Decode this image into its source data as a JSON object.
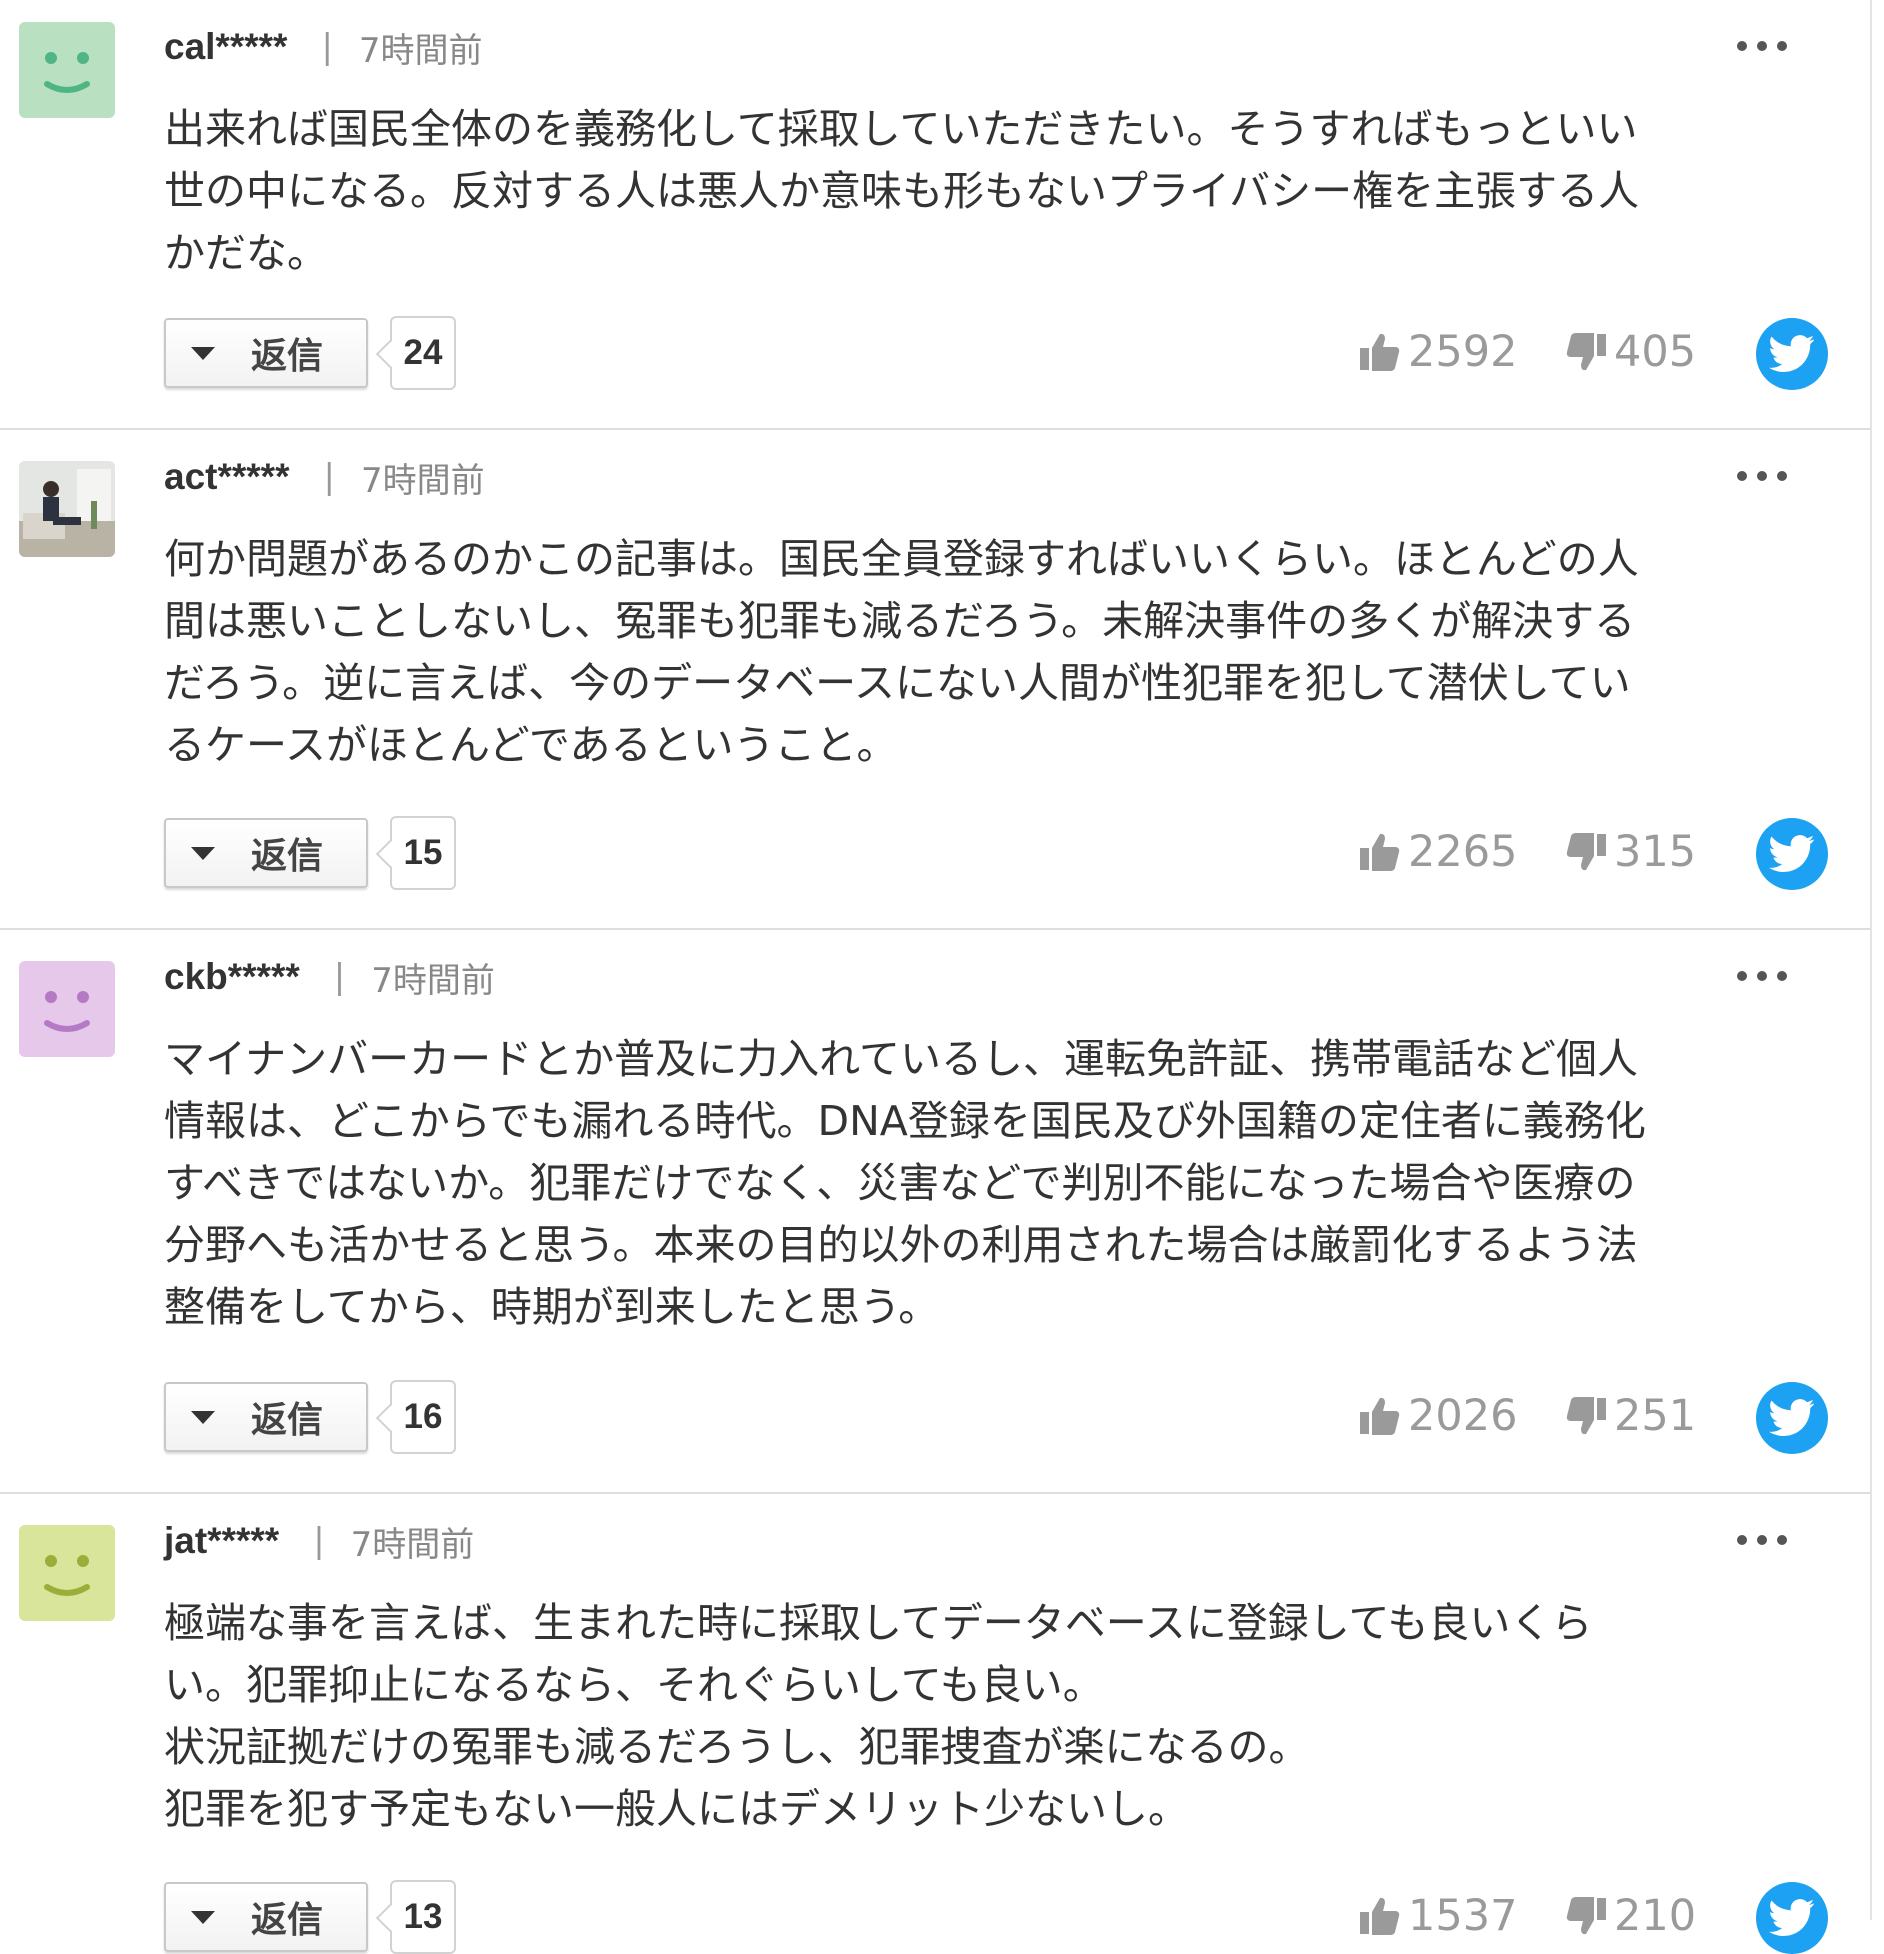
{
  "comments": [
    {
      "user": "cal*****",
      "separator": "|",
      "time": "7時間前",
      "avatar_color": "#b9e0c0",
      "avatar_face": "#4fb584",
      "text": "出来れば国民全体のを義務化して採取していただきたい。そうすればもっといい\n世の中になる。反対する人は悪人か意味も形もないプライバシー権を主張する人\nかだな。",
      "reply_label": "返信",
      "reply_count": "24",
      "likes": "2592",
      "dislikes": "405"
    },
    {
      "user": "act*****",
      "separator": "|",
      "time": "7時間前",
      "avatar_color": "photo",
      "text": "何か問題があるのかこの記事は。国民全員登録すればいいくらい。ほとんどの人\n間は悪いことしないし、冤罪も犯罪も減るだろう。未解決事件の多くが解決する\nだろう。逆に言えば、今のデータベースにない人間が性犯罪を犯して潜伏してい\nるケースがほとんどであるということ。",
      "reply_label": "返信",
      "reply_count": "15",
      "likes": "2265",
      "dislikes": "315"
    },
    {
      "user": "ckb*****",
      "separator": "|",
      "time": "7時間前",
      "avatar_color": "#e6c8ea",
      "avatar_face": "#b57ac6",
      "text": "マイナンバーカードとか普及に力入れているし、運転免許証、携帯電話など個人\n情報は、どこからでも漏れる時代。DNA登録を国民及び外国籍の定住者に義務化\nすべきではないか。犯罪だけでなく、災害などで判別不能になった場合や医療の\n分野へも活かせると思う。本来の目的以外の利用された場合は厳罰化するよう法\n整備をしてから、時期が到来したと思う。",
      "reply_label": "返信",
      "reply_count": "16",
      "likes": "2026",
      "dislikes": "251"
    },
    {
      "user": "jat*****",
      "separator": "|",
      "time": "7時間前",
      "avatar_color": "#d9e59a",
      "avatar_face": "#9aae3a",
      "text": "極端な事を言えば、生まれた時に採取してデータベースに登録しても良いくら\nい。犯罪抑止になるなら、それぐらいしても良い。\n状況証拠だけの冤罪も減るだろうし、犯罪捜査が楽になるの。\n犯罪を犯す予定もない一般人にはデメリット少ないし。",
      "reply_label": "返信",
      "reply_count": "13",
      "likes": "1537",
      "dislikes": "210"
    }
  ],
  "colors": {
    "twitter_blue": "#1da1f2",
    "vote_gray": "#9a9a9a",
    "divider": "#dedede"
  }
}
